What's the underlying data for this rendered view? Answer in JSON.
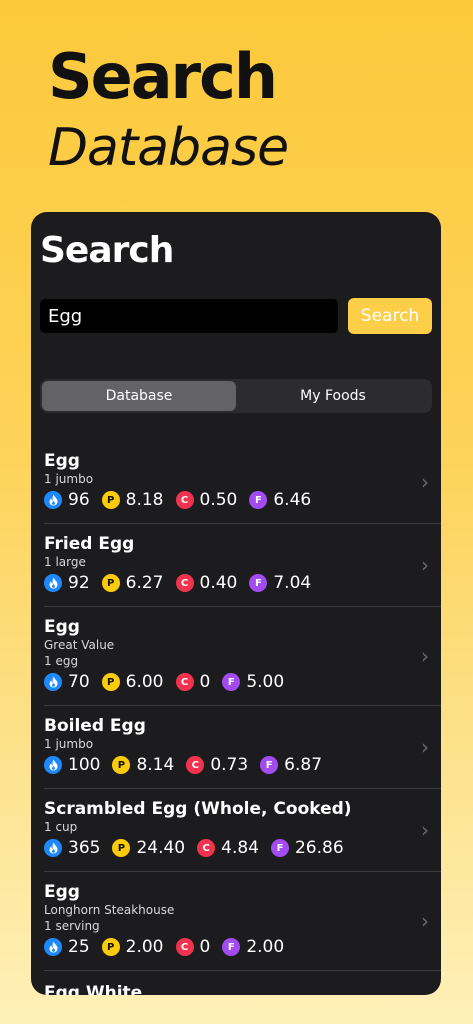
{
  "hero": {
    "title": "Search",
    "subtitle": "Database"
  },
  "panel": {
    "title": "Search",
    "search": {
      "value": "Egg",
      "button_label": "Search"
    },
    "tabs": [
      {
        "label": "Database",
        "active": true
      },
      {
        "label": "My Foods",
        "active": false
      }
    ],
    "results": [
      {
        "name": "Egg",
        "brand": "",
        "serving": "1 jumbo",
        "calories": "96",
        "protein": "8.18",
        "carbs": "0.50",
        "fat": "6.46"
      },
      {
        "name": "Fried Egg",
        "brand": "",
        "serving": "1 large",
        "calories": "92",
        "protein": "6.27",
        "carbs": "0.40",
        "fat": "7.04"
      },
      {
        "name": "Egg",
        "brand": "Great Value",
        "serving": "1 egg",
        "calories": "70",
        "protein": "6.00",
        "carbs": "0",
        "fat": "5.00"
      },
      {
        "name": "Boiled Egg",
        "brand": "",
        "serving": "1 jumbo",
        "calories": "100",
        "protein": "8.14",
        "carbs": "0.73",
        "fat": "6.87"
      },
      {
        "name": "Scrambled Egg (Whole, Cooked)",
        "brand": "",
        "serving": "1 cup",
        "calories": "365",
        "protein": "24.40",
        "carbs": "4.84",
        "fat": "26.86"
      },
      {
        "name": "Egg",
        "brand": "Longhorn Steakhouse",
        "serving": "1 serving",
        "calories": "25",
        "protein": "2.00",
        "carbs": "0",
        "fat": "2.00"
      }
    ],
    "partial_result": {
      "name": "Egg White"
    },
    "badges": {
      "protein": "P",
      "carbs": "C",
      "fat": "F",
      "calorie_icon": "flame-icon"
    },
    "colors": {
      "accent": "#fdce47",
      "calorie": "#1e88ff",
      "protein": "#fecb08",
      "carbs": "#f2334f",
      "fat": "#a24bf0"
    }
  }
}
